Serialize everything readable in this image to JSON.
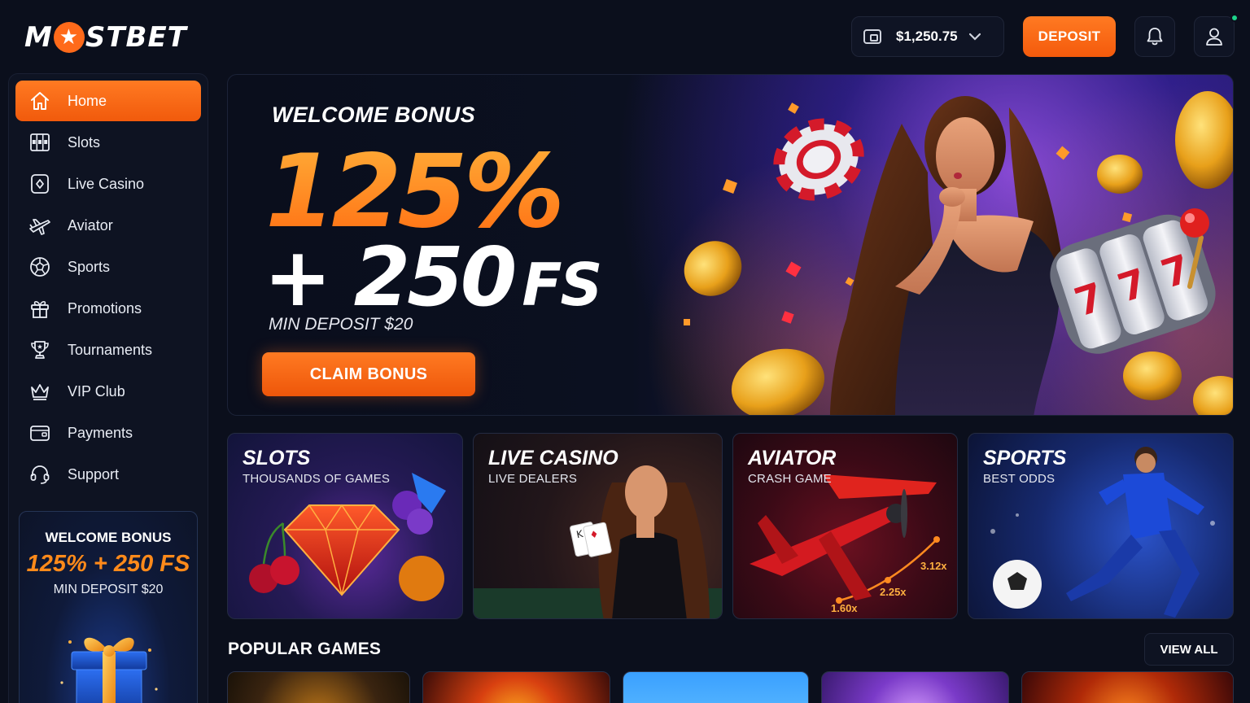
{
  "brand": {
    "logo_text_left": "M",
    "logo_text_right": "STBET"
  },
  "header": {
    "balance": "$1,250.75",
    "deposit_label": "DEPOSIT"
  },
  "sidebar": {
    "items": [
      {
        "label": "Home",
        "icon": "home-icon",
        "active": true
      },
      {
        "label": "Slots",
        "icon": "slots-icon"
      },
      {
        "label": "Live Casino",
        "icon": "live-casino-icon"
      },
      {
        "label": "Aviator",
        "icon": "plane-icon"
      },
      {
        "label": "Sports",
        "icon": "soccer-ball-icon"
      },
      {
        "label": "Promotions",
        "icon": "gift-icon"
      },
      {
        "label": "Tournaments",
        "icon": "trophy-icon"
      },
      {
        "label": "VIP Club",
        "icon": "crown-icon"
      },
      {
        "label": "Payments",
        "icon": "wallet-icon"
      },
      {
        "label": "Support",
        "icon": "headset-icon"
      }
    ],
    "promo": {
      "title": "WELCOME BONUS",
      "offer": "125% + 250 FS",
      "min_deposit": "MIN DEPOSIT $20"
    }
  },
  "hero": {
    "title": "WELCOME BONUS",
    "percent": "125%",
    "free_spins_amount": "+ 250",
    "free_spins_unit": "FS",
    "min_deposit": "MIN DEPOSIT $20",
    "cta": "CLAIM BONUS"
  },
  "categories": [
    {
      "title": "SLOTS",
      "subtitle": "THOUSANDS OF GAMES"
    },
    {
      "title": "LIVE CASINO",
      "subtitle": "LIVE DEALERS"
    },
    {
      "title": "AVIATOR",
      "subtitle": "CRASH GAME",
      "multipliers": [
        "3.12x",
        "2.25x",
        "1.60x"
      ]
    },
    {
      "title": "SPORTS",
      "subtitle": "BEST ODDS"
    }
  ],
  "popular": {
    "title": "POPULAR GAMES",
    "view_all": "VIEW ALL"
  },
  "colors": {
    "accent": "#ff6a1a",
    "background": "#0b0f1c",
    "panel": "#0e1322",
    "online": "#1dd48b"
  }
}
